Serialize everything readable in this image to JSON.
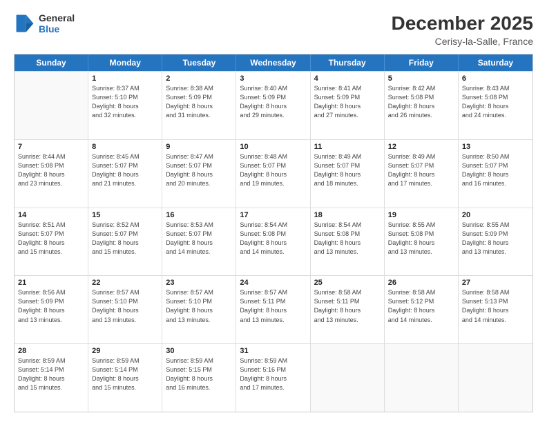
{
  "header": {
    "logo_line1": "General",
    "logo_line2": "Blue",
    "month_title": "December 2025",
    "location": "Cerisy-la-Salle, France"
  },
  "weekdays": [
    "Sunday",
    "Monday",
    "Tuesday",
    "Wednesday",
    "Thursday",
    "Friday",
    "Saturday"
  ],
  "weeks": [
    [
      {
        "day": "",
        "info": ""
      },
      {
        "day": "1",
        "info": "Sunrise: 8:37 AM\nSunset: 5:10 PM\nDaylight: 8 hours\nand 32 minutes."
      },
      {
        "day": "2",
        "info": "Sunrise: 8:38 AM\nSunset: 5:09 PM\nDaylight: 8 hours\nand 31 minutes."
      },
      {
        "day": "3",
        "info": "Sunrise: 8:40 AM\nSunset: 5:09 PM\nDaylight: 8 hours\nand 29 minutes."
      },
      {
        "day": "4",
        "info": "Sunrise: 8:41 AM\nSunset: 5:09 PM\nDaylight: 8 hours\nand 27 minutes."
      },
      {
        "day": "5",
        "info": "Sunrise: 8:42 AM\nSunset: 5:08 PM\nDaylight: 8 hours\nand 26 minutes."
      },
      {
        "day": "6",
        "info": "Sunrise: 8:43 AM\nSunset: 5:08 PM\nDaylight: 8 hours\nand 24 minutes."
      }
    ],
    [
      {
        "day": "7",
        "info": "Sunrise: 8:44 AM\nSunset: 5:08 PM\nDaylight: 8 hours\nand 23 minutes."
      },
      {
        "day": "8",
        "info": "Sunrise: 8:45 AM\nSunset: 5:07 PM\nDaylight: 8 hours\nand 21 minutes."
      },
      {
        "day": "9",
        "info": "Sunrise: 8:47 AM\nSunset: 5:07 PM\nDaylight: 8 hours\nand 20 minutes."
      },
      {
        "day": "10",
        "info": "Sunrise: 8:48 AM\nSunset: 5:07 PM\nDaylight: 8 hours\nand 19 minutes."
      },
      {
        "day": "11",
        "info": "Sunrise: 8:49 AM\nSunset: 5:07 PM\nDaylight: 8 hours\nand 18 minutes."
      },
      {
        "day": "12",
        "info": "Sunrise: 8:49 AM\nSunset: 5:07 PM\nDaylight: 8 hours\nand 17 minutes."
      },
      {
        "day": "13",
        "info": "Sunrise: 8:50 AM\nSunset: 5:07 PM\nDaylight: 8 hours\nand 16 minutes."
      }
    ],
    [
      {
        "day": "14",
        "info": "Sunrise: 8:51 AM\nSunset: 5:07 PM\nDaylight: 8 hours\nand 15 minutes."
      },
      {
        "day": "15",
        "info": "Sunrise: 8:52 AM\nSunset: 5:07 PM\nDaylight: 8 hours\nand 15 minutes."
      },
      {
        "day": "16",
        "info": "Sunrise: 8:53 AM\nSunset: 5:07 PM\nDaylight: 8 hours\nand 14 minutes."
      },
      {
        "day": "17",
        "info": "Sunrise: 8:54 AM\nSunset: 5:08 PM\nDaylight: 8 hours\nand 14 minutes."
      },
      {
        "day": "18",
        "info": "Sunrise: 8:54 AM\nSunset: 5:08 PM\nDaylight: 8 hours\nand 13 minutes."
      },
      {
        "day": "19",
        "info": "Sunrise: 8:55 AM\nSunset: 5:08 PM\nDaylight: 8 hours\nand 13 minutes."
      },
      {
        "day": "20",
        "info": "Sunrise: 8:55 AM\nSunset: 5:09 PM\nDaylight: 8 hours\nand 13 minutes."
      }
    ],
    [
      {
        "day": "21",
        "info": "Sunrise: 8:56 AM\nSunset: 5:09 PM\nDaylight: 8 hours\nand 13 minutes."
      },
      {
        "day": "22",
        "info": "Sunrise: 8:57 AM\nSunset: 5:10 PM\nDaylight: 8 hours\nand 13 minutes."
      },
      {
        "day": "23",
        "info": "Sunrise: 8:57 AM\nSunset: 5:10 PM\nDaylight: 8 hours\nand 13 minutes."
      },
      {
        "day": "24",
        "info": "Sunrise: 8:57 AM\nSunset: 5:11 PM\nDaylight: 8 hours\nand 13 minutes."
      },
      {
        "day": "25",
        "info": "Sunrise: 8:58 AM\nSunset: 5:11 PM\nDaylight: 8 hours\nand 13 minutes."
      },
      {
        "day": "26",
        "info": "Sunrise: 8:58 AM\nSunset: 5:12 PM\nDaylight: 8 hours\nand 14 minutes."
      },
      {
        "day": "27",
        "info": "Sunrise: 8:58 AM\nSunset: 5:13 PM\nDaylight: 8 hours\nand 14 minutes."
      }
    ],
    [
      {
        "day": "28",
        "info": "Sunrise: 8:59 AM\nSunset: 5:14 PM\nDaylight: 8 hours\nand 15 minutes."
      },
      {
        "day": "29",
        "info": "Sunrise: 8:59 AM\nSunset: 5:14 PM\nDaylight: 8 hours\nand 15 minutes."
      },
      {
        "day": "30",
        "info": "Sunrise: 8:59 AM\nSunset: 5:15 PM\nDaylight: 8 hours\nand 16 minutes."
      },
      {
        "day": "31",
        "info": "Sunrise: 8:59 AM\nSunset: 5:16 PM\nDaylight: 8 hours\nand 17 minutes."
      },
      {
        "day": "",
        "info": ""
      },
      {
        "day": "",
        "info": ""
      },
      {
        "day": "",
        "info": ""
      }
    ]
  ]
}
